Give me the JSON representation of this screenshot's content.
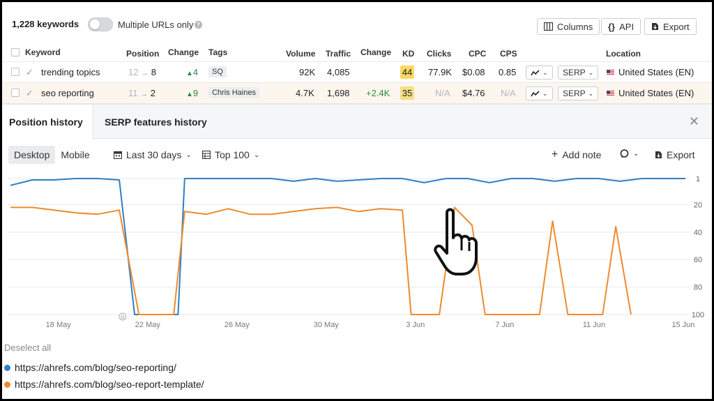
{
  "toolbar": {
    "keywords_count": "1,228 keywords",
    "multiple_urls_label": "Multiple URLs only",
    "multiple_urls_on": false,
    "columns_label": "Columns",
    "api_label": "API",
    "export_label": "Export"
  },
  "table": {
    "headers": {
      "keyword": "Keyword",
      "position": "Position",
      "change": "Change",
      "tags": "Tags",
      "volume": "Volume",
      "traffic": "Traffic",
      "traffic_change": "Change",
      "kd": "KD",
      "clicks": "Clicks",
      "cpc": "CPC",
      "cps": "CPS",
      "location": "Location"
    },
    "rows": [
      {
        "keyword": "trending topics",
        "pos_from": "12",
        "pos_to": "8",
        "change": "4",
        "tag": "SQ",
        "volume": "92K",
        "traffic": "4,085",
        "traffic_change": "",
        "kd": "44",
        "clicks": "77.9K",
        "cpc": "$0.08",
        "cps": "0.85",
        "serp": "SERP",
        "location": "United States (EN)"
      },
      {
        "keyword": "seo reporting",
        "pos_from": "11",
        "pos_to": "2",
        "change": "9",
        "tag": "Chris Haines",
        "volume": "4.7K",
        "traffic": "1,698",
        "traffic_change": "+2.4K",
        "kd": "35",
        "clicks": "N/A",
        "cpc": "$4.76",
        "cps": "N/A",
        "serp": "SERP",
        "location": "United States (EN)"
      }
    ]
  },
  "panel": {
    "tabs": [
      "Position history",
      "SERP features history"
    ],
    "device_tabs": [
      "Desktop",
      "Mobile"
    ],
    "date_range": "Last 30 days",
    "top_filter": "Top 100",
    "add_note": "Add note",
    "export_label": "Export"
  },
  "chart_data": {
    "type": "line",
    "ylabel": "",
    "xlabel": "",
    "y_reversed": true,
    "ylim": [
      1,
      100
    ],
    "y_ticks": [
      "1",
      "20",
      "40",
      "60",
      "80",
      "100"
    ],
    "x_tick_labels": [
      "18 May",
      "22 May",
      "26 May",
      "30 May",
      "3 Jun",
      "7 Jun",
      "11 Jun",
      "15 Jun"
    ],
    "series": [
      {
        "name": "https://ahrefs.com/blog/seo-reporting/",
        "color": "#2f7fc1",
        "points": [
          [
            0,
            6
          ],
          [
            1,
            2
          ],
          [
            2,
            2
          ],
          [
            3,
            0
          ],
          [
            4,
            0
          ],
          [
            5,
            2
          ],
          [
            5.7,
            100
          ],
          [
            7.7,
            100
          ],
          [
            8,
            0
          ],
          [
            9,
            0
          ],
          [
            10,
            0
          ],
          [
            11,
            0
          ],
          [
            12,
            1
          ],
          [
            13,
            3
          ],
          [
            14,
            1
          ],
          [
            15,
            3
          ],
          [
            16,
            2
          ],
          [
            17,
            1
          ],
          [
            18,
            0
          ],
          [
            19,
            4
          ],
          [
            20,
            0
          ],
          [
            21,
            0
          ],
          [
            22,
            4
          ],
          [
            23,
            0
          ],
          [
            24,
            0
          ],
          [
            25,
            3
          ],
          [
            26,
            0
          ],
          [
            27,
            0
          ],
          [
            28,
            3
          ],
          [
            29,
            0
          ],
          [
            30,
            0
          ],
          [
            31,
            0
          ]
        ]
      },
      {
        "name": "https://ahrefs.com/blog/seo-report-template/",
        "color": "#ef8a2b",
        "points": [
          [
            0,
            22
          ],
          [
            1,
            22
          ],
          [
            2,
            24
          ],
          [
            3,
            26
          ],
          [
            4,
            27
          ],
          [
            5,
            24
          ],
          [
            5.9,
            100
          ],
          [
            7.5,
            100
          ],
          [
            8,
            25
          ],
          [
            9,
            27
          ],
          [
            10,
            23
          ],
          [
            11,
            27
          ],
          [
            12,
            27
          ],
          [
            13,
            25
          ],
          [
            14,
            23
          ],
          [
            15,
            22
          ],
          [
            16,
            25
          ],
          [
            17,
            23
          ],
          [
            18,
            24
          ],
          [
            18.4,
            100
          ],
          [
            19.7,
            100
          ],
          [
            20.4,
            22
          ],
          [
            21.2,
            35
          ],
          [
            21.8,
            100
          ],
          [
            24.3,
            100
          ],
          [
            24.9,
            32
          ],
          [
            25.6,
            100
          ],
          [
            27.2,
            100
          ],
          [
            27.8,
            36
          ],
          [
            28.5,
            100
          ]
        ]
      }
    ]
  },
  "legend": {
    "deselect_all": "Deselect all"
  },
  "colors": {
    "accent_blue": "#2f7fc1",
    "accent_orange": "#ef8a2b",
    "kd_yellow": "#f8d962"
  },
  "icons": [
    "help-icon",
    "columns-icon",
    "api-icon",
    "export-icon",
    "check-icon",
    "calendar-icon",
    "table-icon",
    "plus-icon",
    "comment-icon",
    "close-icon",
    "trend-icon",
    "hand-cursor-icon"
  ]
}
